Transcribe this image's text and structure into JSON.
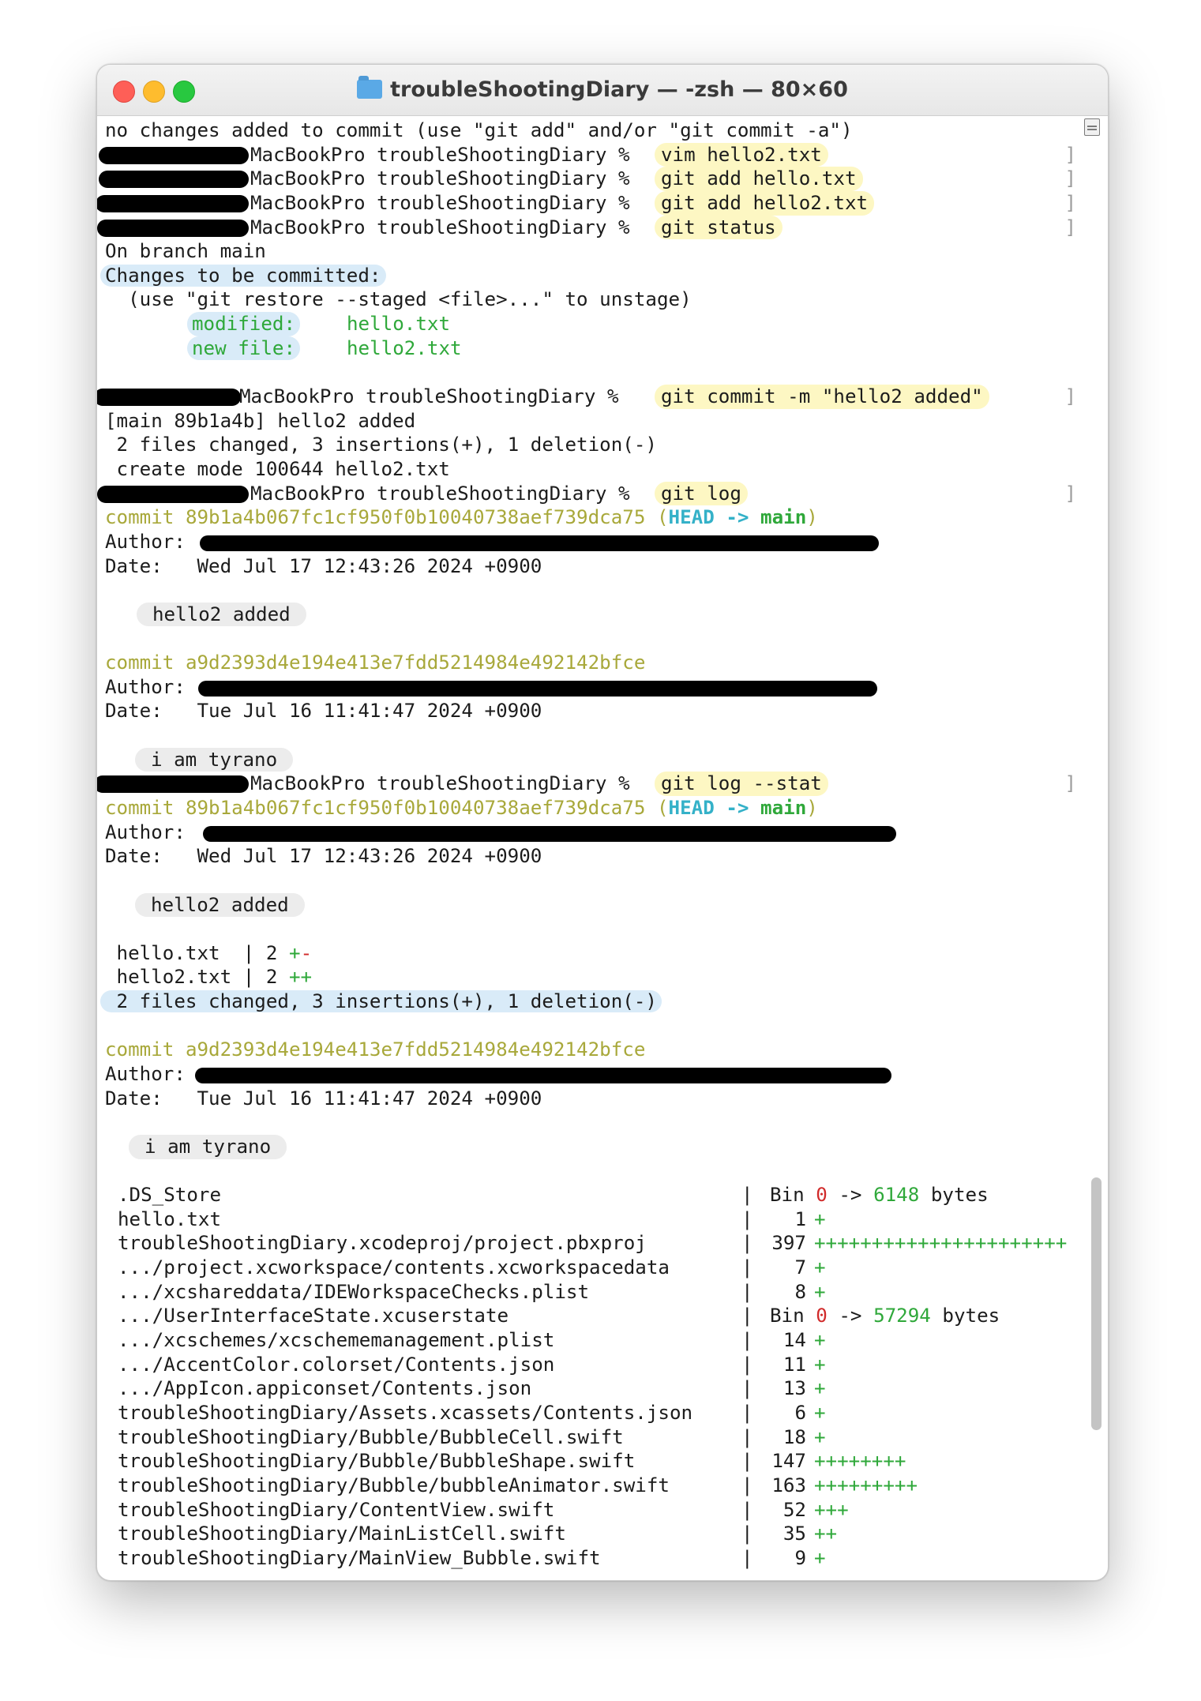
{
  "window": {
    "title": "troubleShootingDiary — -zsh — 80×60"
  },
  "prompt_suffix": "MacBookPro troubleShootingDiary % ",
  "terminal": {
    "l1": "no changes added to commit (use \"git add\" and/or \"git commit -a\")",
    "cmd_vim": "vim hello2.txt",
    "cmd_add1": "git add hello.txt",
    "cmd_add2": "git add hello2.txt",
    "cmd_status": "git status",
    "on_branch": "On branch main",
    "changes": "Changes to be committed:",
    "restore_hint": "  (use \"git restore --staged <file>...\" to unstage)",
    "modified_label": "modified:",
    "modified_file": "hello.txt",
    "newfile_label": "new file:",
    "newfile_file": "hello2.txt",
    "cmd_commit": "git commit -m \"hello2 added\"",
    "commit_out1": "[main 89b1a4b] hello2 added",
    "commit_out2": " 2 files changed, 3 insertions(+), 1 deletion(-)",
    "commit_out3": " create mode 100644 hello2.txt",
    "cmd_log": "git log",
    "commit_word": "commit ",
    "sha1": "89b1a4b067fc1cf950f0b10040738aef739dca75",
    "head_open": " (",
    "head": "HEAD -> ",
    "main": "main",
    "head_close": ")",
    "author_label": "Author:",
    "date_label": "Date:   ",
    "date1": "Wed Jul 17 12:43:26 2024 +0900",
    "msg1": "hello2 added",
    "sha2": "a9d2393d4e194e413e7fdd5214984e492142bfce",
    "date2": "Tue Jul 16 11:41:47 2024 +0900",
    "msg2": "i am tyrano",
    "cmd_logstat": "git log --stat",
    "stat1_file": " hello.txt  | 2 ",
    "stat1_plus": "+",
    "stat1_minus": "-",
    "stat2_file": " hello2.txt | 2 ",
    "stat2_plus": "++",
    "stat_summary": " 2 files changed, 3 insertions(+), 1 deletion(-)"
  },
  "stats": [
    {
      "path": ".DS_Store",
      "bin": true,
      "from": "0",
      "to": "6148",
      "unit": "bytes"
    },
    {
      "path": "hello.txt",
      "num": "1",
      "plus": "+"
    },
    {
      "path": "troubleShootingDiary.xcodeproj/project.pbxproj",
      "num": "397",
      "plus": "++++++++++++++++++++++"
    },
    {
      "path": ".../project.xcworkspace/contents.xcworkspacedata",
      "num": "7",
      "plus": "+"
    },
    {
      "path": ".../xcshareddata/IDEWorkspaceChecks.plist",
      "num": "8",
      "plus": "+"
    },
    {
      "path": ".../UserInterfaceState.xcuserstate",
      "bin": true,
      "from": "0",
      "to": "57294",
      "unit": "bytes"
    },
    {
      "path": ".../xcschemes/xcschememanagement.plist",
      "num": "14",
      "plus": "+"
    },
    {
      "path": ".../AccentColor.colorset/Contents.json",
      "num": "11",
      "plus": "+"
    },
    {
      "path": ".../AppIcon.appiconset/Contents.json",
      "num": "13",
      "plus": "+"
    },
    {
      "path": "troubleShootingDiary/Assets.xcassets/Contents.json",
      "num": "6",
      "plus": "+"
    },
    {
      "path": "troubleShootingDiary/Bubble/BubbleCell.swift",
      "num": "18",
      "plus": "+"
    },
    {
      "path": "troubleShootingDiary/Bubble/BubbleShape.swift",
      "num": "147",
      "plus": "++++++++"
    },
    {
      "path": "troubleShootingDiary/Bubble/bubbleAnimator.swift",
      "num": "163",
      "plus": "+++++++++"
    },
    {
      "path": "troubleShootingDiary/ContentView.swift",
      "num": "52",
      "plus": "+++"
    },
    {
      "path": "troubleShootingDiary/MainListCell.swift",
      "num": "35",
      "plus": "++"
    },
    {
      "path": "troubleShootingDiary/MainView_Bubble.swift",
      "num": "9",
      "plus": "+"
    }
  ],
  "stat_labels": {
    "bin": "Bin",
    "arrow": " -> "
  },
  "colors": {
    "sha": "#a8a83a",
    "head": "#34b1c8",
    "plus": "#2fa83a",
    "minus": "#d12b2b",
    "highlight_yellow": "#fdf7c3",
    "highlight_blue": "#d9ebf8"
  }
}
